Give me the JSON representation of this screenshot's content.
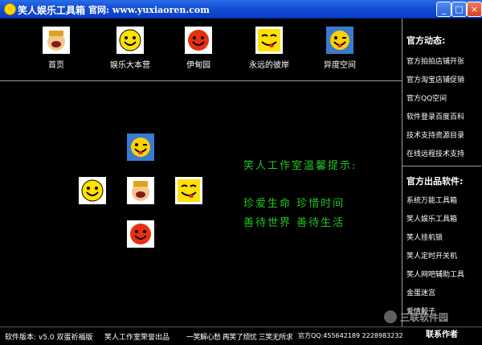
{
  "window": {
    "title": "笑人娱乐工具箱",
    "site": "官网: www.yuxiaoren.com",
    "min": "_",
    "max": "□",
    "close": "×"
  },
  "nav": [
    {
      "label": "首页",
      "icon": "laughing-man-icon"
    },
    {
      "label": "娱乐大本营",
      "icon": "smiley-icon"
    },
    {
      "label": "伊甸园",
      "icon": "red-smiley-icon"
    },
    {
      "label": "永远的彼岸",
      "icon": "tongue-smiley-icon"
    },
    {
      "label": "异度空间",
      "icon": "wink-smiley-icon"
    }
  ],
  "message": {
    "title": "笑人工作室温馨提示:",
    "line1": "珍爱生命  珍惜时间",
    "line2": "善待世界  善待生活"
  },
  "sidebar": {
    "news_title": "官方动态:",
    "news": [
      "官方拍拍店铺开张",
      "官方淘宝店铺促销",
      "官方QQ空间",
      "软件登录百度百科",
      "技术支持资源目录",
      "在线远程技术支持"
    ],
    "products_title": "官方出品软件:",
    "products": [
      "系统万能工具箱",
      "笑人娱乐工具箱",
      "笑人挂机锁",
      "笑人定时开关机",
      "笑人网吧辅助工具",
      "金蛋迷宫",
      "爱情骰子"
    ]
  },
  "status": {
    "version": "软件版本: v5.0 双蛋祈福版",
    "studio": "笑人工作室荣誉出品",
    "slogan": "一笑解心愁 再笑了烦忧 三笑无所求",
    "qq": "官方QQ:455642189 2228983232",
    "contact": "联系作者"
  },
  "watermark": "三联软件园",
  "colors": {
    "titlebar": "#1650d6",
    "message": "#23c623"
  }
}
